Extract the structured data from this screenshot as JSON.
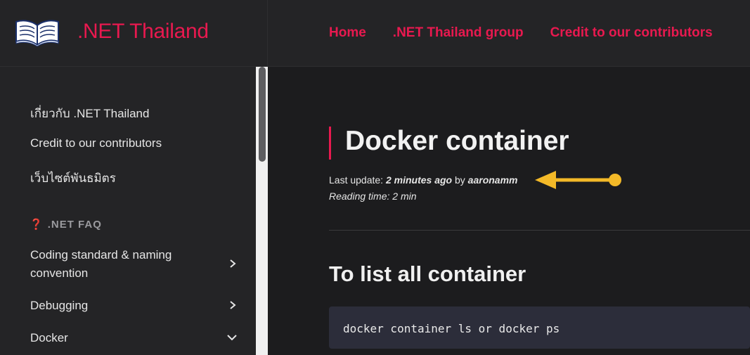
{
  "brand": {
    "title": ".NET Thailand",
    "logo_icon": "open-book-icon"
  },
  "nav": [
    {
      "label": "Home"
    },
    {
      "label": ".NET Thailand group"
    },
    {
      "label": "Credit to our contributors"
    }
  ],
  "sidebar": {
    "links": [
      {
        "label": "เกี่ยวกับ .NET Thailand"
      },
      {
        "label": "Credit to our contributors"
      },
      {
        "label": "เว็บไซต์พันธมิตร"
      }
    ],
    "section": {
      "icon": "question-icon",
      "icon_glyph": "❓",
      "label": ".NET FAQ"
    },
    "items": [
      {
        "label": "Coding standard & naming convention",
        "icon": "chevron-right-icon"
      },
      {
        "label": "Debugging",
        "icon": "chevron-right-icon"
      },
      {
        "label": "Docker",
        "icon": "chevron-down-icon"
      }
    ]
  },
  "article": {
    "title": "Docker container",
    "meta": {
      "last_update_label": "Last update:",
      "last_update_value": "2 minutes ago",
      "by_label": "by",
      "author": "aaronamm",
      "reading_time": "Reading time: 2 min"
    },
    "section_heading": "To list all container",
    "code": "docker container ls or docker ps"
  },
  "colors": {
    "accent": "#e8194f",
    "annotation_arrow": "#f3b928",
    "header_bg": "#242426",
    "main_bg": "#1c1c1e",
    "code_bg": "#2c2d3a"
  }
}
